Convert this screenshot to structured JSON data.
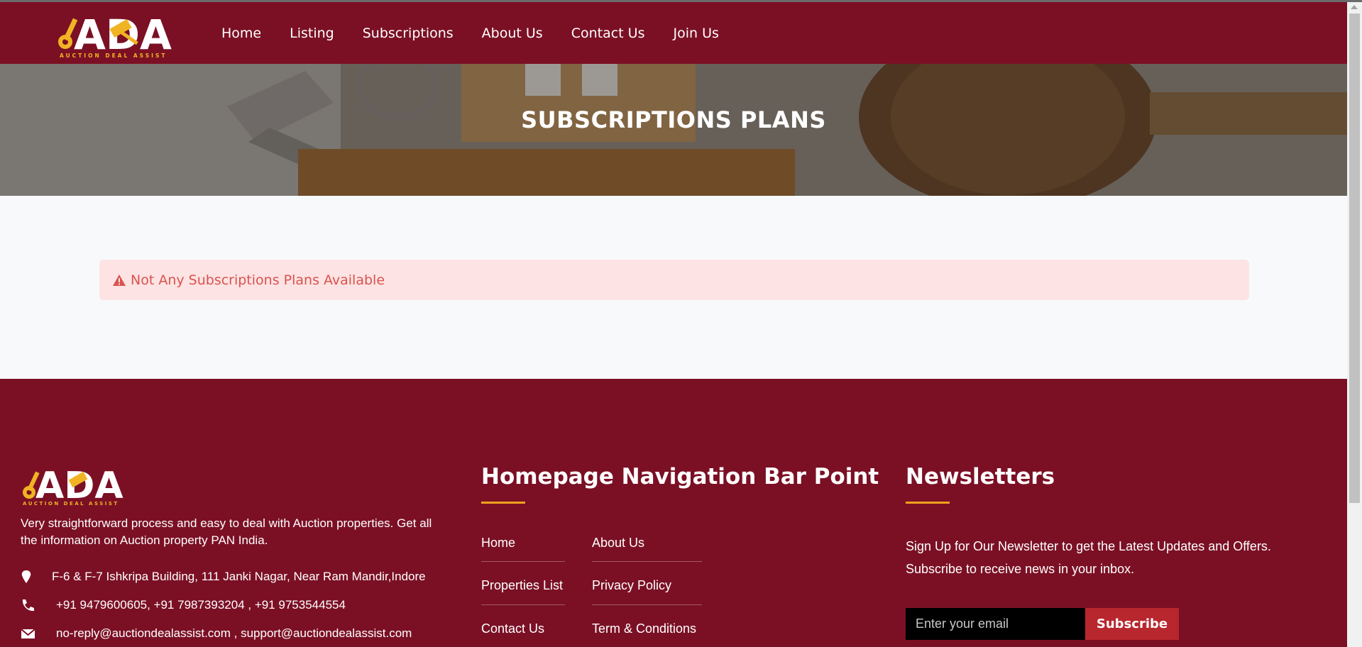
{
  "brand": {
    "logo_text": "ADA",
    "logo_tagline": "AUCTION DEAL ASSIST"
  },
  "nav": {
    "items": [
      "Home",
      "Listing",
      "Subscriptions",
      "About Us",
      "Contact Us",
      "Join Us"
    ]
  },
  "hero": {
    "title": "SUBSCRIPTIONS PLANS"
  },
  "alert": {
    "message": "Not Any Subscriptions Plans Available",
    "icon": "warning-icon",
    "color": "#d9534f",
    "background": "#fde3e3"
  },
  "footer": {
    "description": "Very straightforward process and easy to deal with Auction properties. Get all the information on Auction property PAN India.",
    "address": "F-6 & F-7 Ishkripa Building, 111 Janki Nagar, Near Ram Mandir,Indore",
    "phone": "+91 9479600605, +91 7987393204 , +91 9753544554",
    "email": "no-reply@auctiondealassist.com , support@auctiondealassist.com",
    "nav_heading": "Homepage Navigation Bar Point",
    "links_col1": [
      "Home",
      "Properties List",
      "Contact Us"
    ],
    "links_col2": [
      "About Us",
      "Privacy Policy",
      "Term & Conditions"
    ],
    "newsletter_heading": "Newsletters",
    "newsletter_text": "Sign Up for Our Newsletter to get the Latest Updates and Offers. Subscribe to receive news in your inbox.",
    "email_placeholder": "Enter your email",
    "subscribe_label": "Subscribe"
  },
  "colors": {
    "primary": "#7b1025",
    "accent": "#f0a21e",
    "button": "#b8262e"
  }
}
